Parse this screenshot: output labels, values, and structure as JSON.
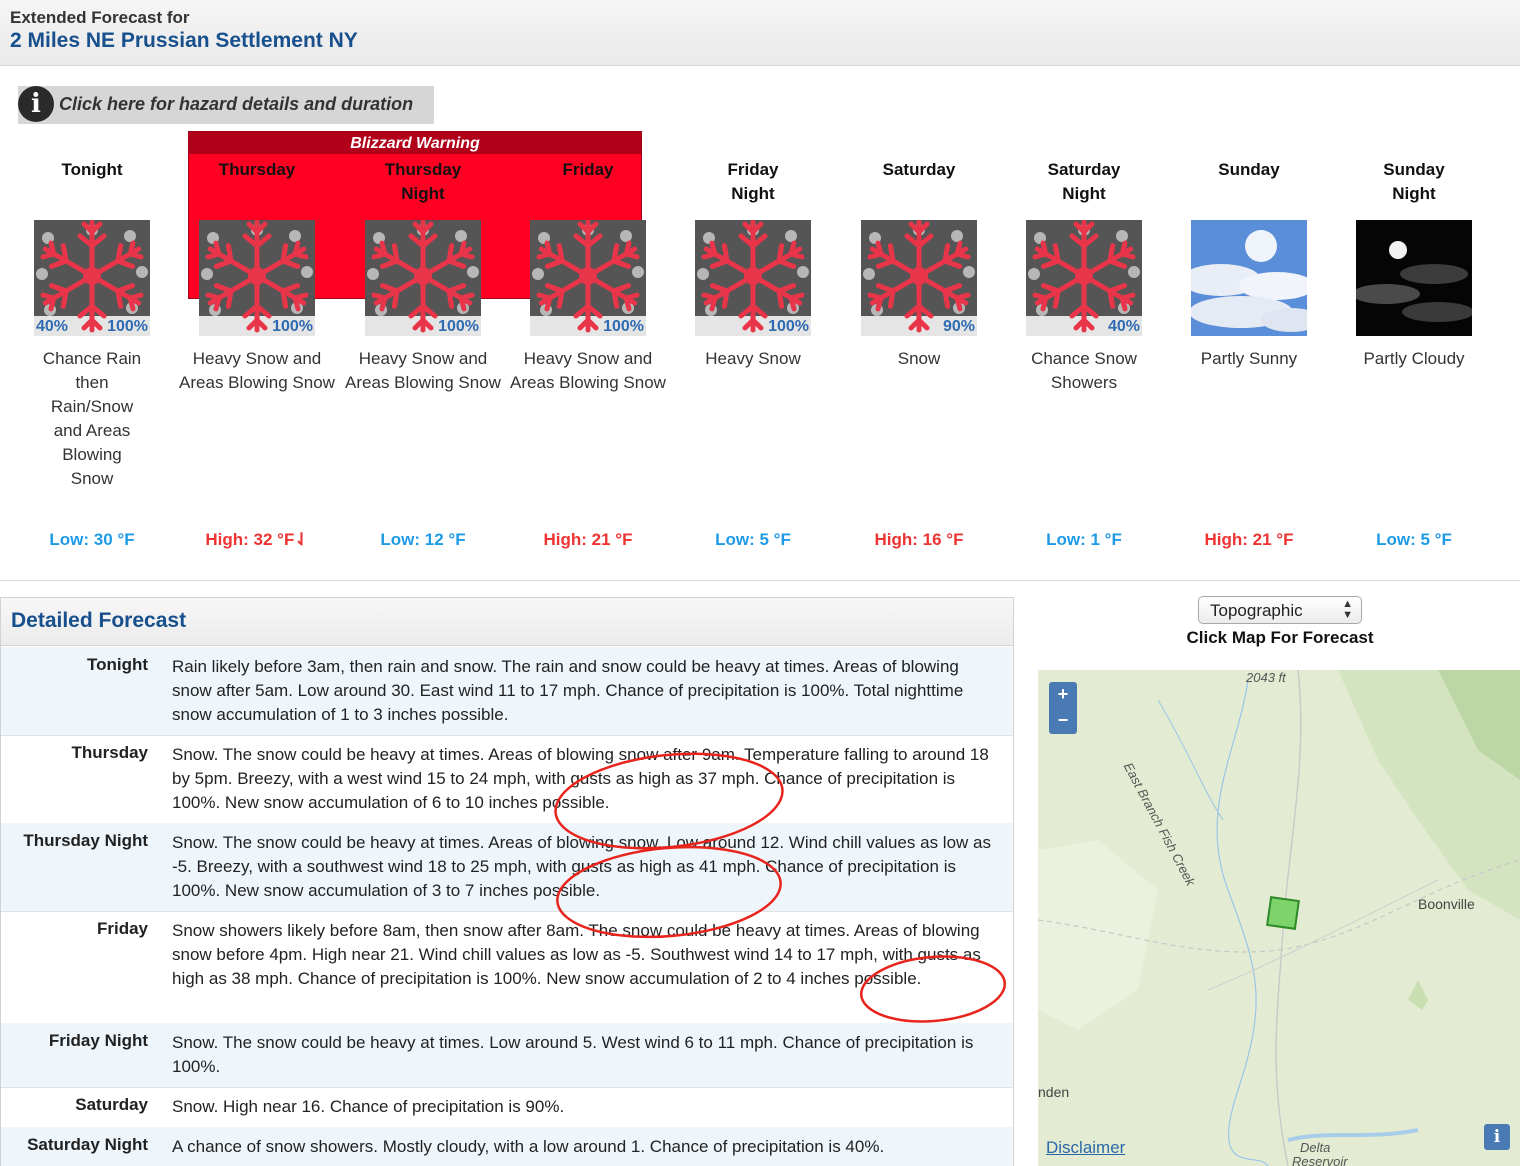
{
  "header": {
    "label": "Extended Forecast for",
    "location": "2 Miles NE Prussian Settlement NY"
  },
  "hazard": {
    "icon": "info-icon",
    "label": "Click here for hazard details and duration"
  },
  "warning_band": {
    "title": "Blizzard Warning",
    "color": "#ff0022"
  },
  "periods": [
    {
      "name": "Tonight",
      "name2": "",
      "pop": "40%",
      "pop2": "100%",
      "icon": "snow-icon",
      "desc": "Chance Rain then Rain/Snow and Areas Blowing Snow",
      "temp": "Low: 30 °F",
      "kind": "low"
    },
    {
      "name": "Thursday",
      "name2": "",
      "pop": "",
      "pop2": "100%",
      "icon": "snow-icon",
      "desc": "Heavy Snow and Areas Blowing Snow",
      "temp": "High: 32 °F⇃",
      "kind": "high"
    },
    {
      "name": "Thursday",
      "name2": "Night",
      "pop": "",
      "pop2": "100%",
      "icon": "snow-icon",
      "desc": "Heavy Snow and Areas Blowing Snow",
      "temp": "Low: 12 °F",
      "kind": "low"
    },
    {
      "name": "Friday",
      "name2": "",
      "pop": "",
      "pop2": "100%",
      "icon": "snow-icon",
      "desc": "Heavy Snow and Areas Blowing Snow",
      "temp": "High: 21 °F",
      "kind": "high"
    },
    {
      "name": "Friday",
      "name2": "Night",
      "pop": "",
      "pop2": "100%",
      "icon": "snow-icon",
      "desc": "Heavy Snow",
      "temp": "Low: 5 °F",
      "kind": "low"
    },
    {
      "name": "Saturday",
      "name2": "",
      "pop": "",
      "pop2": "90%",
      "icon": "snow-icon",
      "desc": "Snow",
      "temp": "High: 16 °F",
      "kind": "high"
    },
    {
      "name": "Saturday",
      "name2": "Night",
      "pop": "",
      "pop2": "40%",
      "icon": "snow-icon",
      "desc": "Chance Snow Showers",
      "temp": "Low: 1 °F",
      "kind": "low"
    },
    {
      "name": "Sunday",
      "name2": "",
      "pop": "",
      "pop2": "",
      "icon": "partly-sunny-icon",
      "desc": "Partly Sunny",
      "temp": "High: 21 °F",
      "kind": "high"
    },
    {
      "name": "Sunday",
      "name2": "Night",
      "pop": "",
      "pop2": "",
      "icon": "partly-cloudy-night-icon",
      "desc": "Partly Cloudy",
      "temp": "Low: 5 °F",
      "kind": "low"
    }
  ],
  "detailed": {
    "title": "Detailed Forecast",
    "rows": [
      {
        "label": "Tonight",
        "text": "Rain likely before 3am, then rain and snow. The rain and snow could be heavy at times. Areas of blowing snow after 5am. Low around 30. East wind 11 to 17 mph. Chance of precipitation is 100%. Total nighttime snow accumulation of 1 to 3 inches possible."
      },
      {
        "label": "Thursday",
        "text": "Snow. The snow could be heavy at times. Areas of blowing snow after 9am. Temperature falling to around 18 by 5pm. Breezy, with a west wind 15 to 24 mph, with gusts as high as 37 mph. Chance of precipitation is 100%. New snow accumulation of 6 to 10 inches possible."
      },
      {
        "label": "Thursday Night",
        "text": "Snow. The snow could be heavy at times. Areas of blowing snow. Low around 12. Wind chill values as low as -5. Breezy, with a southwest wind 18 to 25 mph, with gusts as high as 41 mph. Chance of precipitation is 100%. New snow accumulation of 3 to 7 inches possible."
      },
      {
        "label": "Friday",
        "text": "Snow showers likely before 8am, then snow after 8am. The snow could be heavy at times. Areas of blowing snow before 4pm. High near 21. Wind chill values as low as -5. Southwest wind 14 to 17 mph, with gusts as high as 38 mph. Chance of precipitation is 100%. New snow accumulation of 2 to 4 inches possible."
      },
      {
        "label": "Friday Night",
        "text": "Snow. The snow could be heavy at times. Low around 5. West wind 6 to 11 mph. Chance of precipitation is 100%."
      },
      {
        "label": "Saturday",
        "text": "Snow. High near 16. Chance of precipitation is 90%."
      },
      {
        "label": "Saturday Night",
        "text": "A chance of snow showers. Mostly cloudy, with a low around 1. Chance of precipitation is 40%."
      }
    ]
  },
  "map": {
    "select_value": "Topographic",
    "caption": "Click Map For Forecast",
    "zoom_in": "+",
    "zoom_out": "−",
    "elev_label": "2043 ft",
    "creek_label": "East Branch Fish Creek",
    "town_label": "Boonville",
    "left_label": "nden",
    "delta_label": "Delta",
    "delta_label2": "Reservoir",
    "disclaimer": "Disclaimer",
    "info": "i"
  },
  "annotations": {
    "color": "#e8241c"
  }
}
